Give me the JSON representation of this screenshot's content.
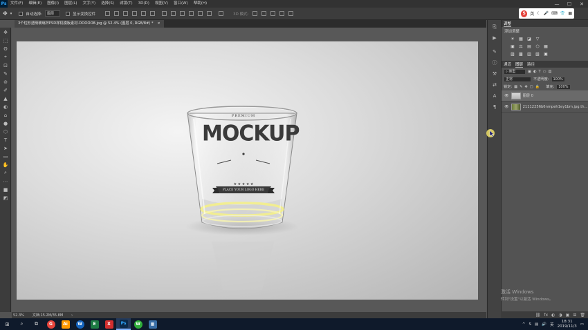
{
  "app": {
    "logo": "Ps"
  },
  "menu": [
    "文件(F)",
    "编辑(E)",
    "图像(I)",
    "图层(L)",
    "文字(Y)",
    "选择(S)",
    "滤镜(T)",
    "3D(D)",
    "视图(V)",
    "窗口(W)",
    "帮助(H)"
  ],
  "window_controls": {
    "minimize": "—",
    "maximize": "☐",
    "close": "✕"
  },
  "options_bar": {
    "auto_select_label": "自动选择:",
    "auto_select_value": "图层",
    "transform_label": "显示变换控件",
    "mode_3d_label": "3D 模式:"
  },
  "ime": {
    "logo": "S",
    "lang": "英"
  },
  "document_tab": {
    "title": "3个柱形透明玻璃杯PSD样机模板素材-DOOOO8.jpg @ 52.4% (图层 0, RGB/8#) *",
    "close": "×"
  },
  "tools": [
    "✥",
    "⬚",
    "ʘ",
    "⌖",
    "⊡",
    "✎",
    "⊘",
    "✐",
    "▲",
    "◐",
    "⌂",
    "●",
    "⬡",
    "T",
    "➤",
    "▭",
    "✋",
    "⌕",
    "⋯",
    "■",
    "◩"
  ],
  "status": {
    "zoom": "52.3%",
    "doc": "文档:15.2M/35.8M",
    "arrow": "›"
  },
  "mock": {
    "premium": "PREMIUM",
    "title": "MOCKUP",
    "tagline": "PLACE YOUR LOGO HERE"
  },
  "right_panel": {
    "adjust_tab": "调整",
    "adjust_add": "添加调整",
    "adjust_icons": [
      [
        "☀",
        "▦",
        "◪",
        "▽"
      ],
      [
        "▣",
        "⚖",
        "▤",
        "⬡",
        "▦"
      ],
      [
        "▨",
        "▩",
        "▥",
        "▧",
        "▣"
      ]
    ],
    "layer_tabs": [
      "通道",
      "图层",
      "路径"
    ],
    "active_layer_tab": "图层",
    "filter_label": "类型",
    "blend_mode": "正常",
    "opacity_label": "不透明度:",
    "opacity_value": "100%",
    "lock_label": "锁定:",
    "fill_label": "填充:",
    "fill_value": "100%",
    "layers": [
      {
        "name": "图层 0",
        "selected": true
      },
      {
        "name": "21112256b6nmpeh1ey1bm.jpg.th..."
      }
    ],
    "bottom_icons": [
      "⛓",
      "fx",
      "◐",
      "◑",
      "▣",
      "⊞",
      "🗑"
    ]
  },
  "watermark": {
    "line1": "激活 Windows",
    "line2": "转到\"设置\"以激活 Windows。"
  },
  "taskbar": {
    "start": "⊞",
    "search": "⌕",
    "taskview": "⧉",
    "apps": [
      {
        "label": "G",
        "color": "#e8453c"
      },
      {
        "label": "Ai",
        "color": "#ff9a00"
      },
      {
        "label": "W",
        "color": "#1565c0"
      },
      {
        "label": "E",
        "color": "#1d7a43"
      },
      {
        "label": "X",
        "color": "#d32f2f"
      },
      {
        "label": "Ps",
        "color": "#0a2a4a"
      },
      {
        "label": "W",
        "color": "#2fae3a"
      },
      {
        "label": "▦",
        "color": "#3a6ea5"
      }
    ],
    "active_app_index": 5
  },
  "tray": {
    "up": "^",
    "lang": "英",
    "time": "18:31",
    "date": "2019/11/3",
    "notify": "▭"
  },
  "colors": {
    "accent": "#31a8ff",
    "glow": "#f4f08a"
  }
}
